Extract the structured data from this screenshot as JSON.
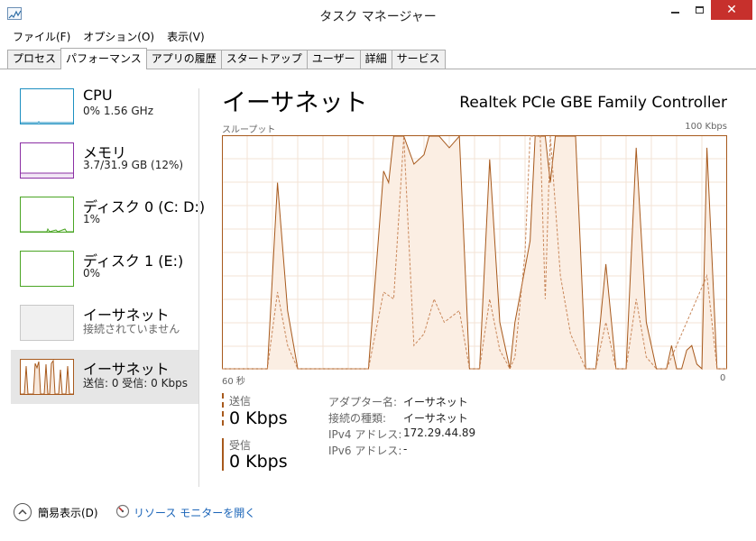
{
  "window": {
    "title": "タスク マネージャー",
    "close_glyph": "✕"
  },
  "menu": [
    "ファイル(F)",
    "オプション(O)",
    "表示(V)"
  ],
  "tabs": [
    "プロセス",
    "パフォーマンス",
    "アプリの履歴",
    "スタートアップ",
    "ユーザー",
    "詳細",
    "サービス"
  ],
  "active_tab": "パフォーマンス",
  "sidebar": [
    {
      "title": "CPU",
      "sub": "0%  1.56 GHz",
      "color": "#1c8fc1"
    },
    {
      "title": "メモリ",
      "sub": "3.7/31.9 GB (12%)",
      "color": "#8b2fa4"
    },
    {
      "title": "ディスク 0 (C: D:)",
      "sub": "1%",
      "color": "#4aa524"
    },
    {
      "title": "ディスク 1 (E:)",
      "sub": "0%",
      "color": "#4aa524"
    },
    {
      "title": "イーサネット",
      "sub": "接続されていません",
      "color": "#b8b8b8"
    },
    {
      "title": "イーサネット",
      "sub": "送信: 0  受信: 0 Kbps",
      "color": "#a7591c"
    }
  ],
  "main": {
    "title": "イーサネット",
    "adapter": "Realtek PCIe GBE Family Controller",
    "graph_label": "スループット",
    "graph_max": "100 Kbps",
    "x_left": "60 秒",
    "x_right": "0",
    "accent": "#a7591c"
  },
  "legend": {
    "send_label": "送信",
    "send_value": "0 Kbps",
    "recv_label": "受信",
    "recv_value": "0 Kbps"
  },
  "info": [
    {
      "key": "アダプター名:",
      "value": "イーサネット"
    },
    {
      "key": "接続の種類:",
      "value": "イーサネット"
    },
    {
      "key": "IPv4 アドレス:",
      "value": "172.29.44.89"
    },
    {
      "key": "IPv6 アドレス:",
      "value": "-"
    }
  ],
  "footer": {
    "fewer_details": "簡易表示(D)",
    "resource_monitor": "リソース モニターを開く"
  },
  "graph_series": {
    "receive_percent": [
      0,
      0,
      0,
      0,
      0,
      0,
      0,
      0,
      0,
      0,
      80,
      0,
      0,
      0,
      0,
      0,
      0,
      0,
      0,
      0,
      0,
      0,
      0,
      0,
      0,
      0,
      0,
      0,
      0,
      0,
      0,
      0,
      0,
      0,
      0,
      0,
      0,
      0,
      0,
      0,
      0,
      0,
      0,
      0,
      0,
      0,
      0,
      0,
      0,
      0,
      0,
      0,
      0,
      0,
      0,
      0,
      0,
      0,
      0,
      0,
      0,
      0,
      0,
      0,
      0,
      0,
      0,
      0,
      0,
      0,
      0,
      0,
      0,
      0,
      0,
      0,
      80,
      0,
      0,
      0,
      0,
      0,
      0,
      0,
      0,
      0,
      0,
      0,
      0,
      0,
      0,
      0,
      0,
      0,
      0,
      0,
      0,
      0,
      0,
      0,
      0,
      0,
      0,
      0,
      0,
      0,
      0,
      0,
      0,
      0,
      0,
      0,
      0,
      0,
      0,
      0,
      0,
      0,
      0,
      0,
      0,
      0,
      0,
      0,
      0,
      0,
      0,
      0,
      0,
      0,
      0,
      0,
      0,
      0,
      0,
      0,
      0,
      0,
      0,
      0,
      0,
      0,
      0,
      0,
      0,
      0,
      0,
      0,
      0,
      0,
      0,
      0,
      0,
      0,
      0,
      0,
      0,
      0,
      0,
      0,
      0,
      0,
      0,
      0,
      0,
      0
    ],
    "receive_points": [
      [
        0,
        0
      ],
      [
        9,
        0
      ],
      [
        11,
        80
      ],
      [
        13,
        25
      ],
      [
        15,
        0
      ],
      [
        29,
        0
      ],
      [
        32,
        85
      ],
      [
        33,
        80
      ],
      [
        34,
        100
      ],
      [
        36,
        100
      ],
      [
        38,
        88
      ],
      [
        40,
        92
      ],
      [
        41,
        100
      ],
      [
        43,
        100
      ],
      [
        45,
        95
      ],
      [
        47,
        100
      ],
      [
        49,
        0
      ],
      [
        51,
        0
      ],
      [
        53,
        90
      ],
      [
        55,
        20
      ],
      [
        57,
        0
      ],
      [
        58,
        20
      ],
      [
        61,
        55
      ],
      [
        62,
        100
      ],
      [
        64,
        100
      ],
      [
        65,
        80
      ],
      [
        66,
        100
      ],
      [
        68,
        100
      ],
      [
        70,
        100
      ],
      [
        72,
        0
      ],
      [
        74,
        0
      ],
      [
        76,
        45
      ],
      [
        78,
        0
      ],
      [
        80,
        0
      ],
      [
        82,
        95
      ],
      [
        84,
        20
      ],
      [
        86,
        0
      ],
      [
        88,
        0
      ],
      [
        89,
        10
      ],
      [
        90,
        0
      ],
      [
        91,
        0
      ],
      [
        92,
        8
      ],
      [
        93,
        10
      ],
      [
        94,
        2
      ],
      [
        95,
        0
      ],
      [
        96,
        95
      ],
      [
        98,
        0
      ],
      [
        100,
        0
      ]
    ],
    "send_points": [
      [
        0,
        0
      ],
      [
        9,
        0
      ],
      [
        11,
        33
      ],
      [
        13,
        10
      ],
      [
        15,
        0
      ],
      [
        29,
        0
      ],
      [
        32,
        33
      ],
      [
        34,
        30
      ],
      [
        36,
        100
      ],
      [
        38,
        10
      ],
      [
        40,
        15
      ],
      [
        42,
        30
      ],
      [
        44,
        20
      ],
      [
        47,
        25
      ],
      [
        49,
        0
      ],
      [
        51,
        0
      ],
      [
        53,
        30
      ],
      [
        55,
        8
      ],
      [
        57,
        0
      ],
      [
        58,
        5
      ],
      [
        60,
        50
      ],
      [
        61,
        100
      ],
      [
        63,
        100
      ],
      [
        64,
        30
      ],
      [
        65,
        100
      ],
      [
        67,
        40
      ],
      [
        69,
        15
      ],
      [
        72,
        0
      ],
      [
        74,
        0
      ],
      [
        76,
        20
      ],
      [
        78,
        0
      ],
      [
        80,
        0
      ],
      [
        82,
        30
      ],
      [
        84,
        5
      ],
      [
        86,
        0
      ],
      [
        88,
        0
      ],
      [
        96,
        40
      ],
      [
        98,
        0
      ],
      [
        100,
        0
      ]
    ]
  }
}
